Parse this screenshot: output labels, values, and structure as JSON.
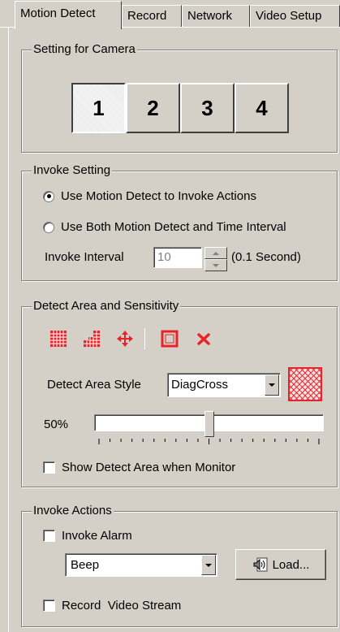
{
  "tabs": [
    "Motion Detect",
    "Record",
    "Network",
    "Video Setup"
  ],
  "camera_group": {
    "title": "Setting for Camera",
    "buttons": [
      "1",
      "2",
      "3",
      "4"
    ],
    "selected": "1"
  },
  "invoke_setting": {
    "title": "Invoke Setting",
    "option1": "Use Motion Detect to Invoke Actions",
    "option2": "Use Both Motion Detect and Time Interval",
    "selected": "option1",
    "interval_label": "Invoke Interval",
    "interval_value": "10",
    "interval_unit": "(0.1 Second)"
  },
  "detect_area": {
    "title": "Detect Area and Sensitivity",
    "tools": [
      "grid-all-icon",
      "grid-stairs-icon",
      "move-icon",
      "select-rect-icon",
      "clear-icon"
    ],
    "style_label": "Detect Area Style",
    "style_value": "DiagCross",
    "sensitivity_label": "50%",
    "sensitivity_value": 50,
    "show_label": "Show Detect Area when Monitor",
    "accent": "#e8242a"
  },
  "invoke_actions": {
    "title": "Invoke Actions",
    "alarm_label": "Invoke Alarm",
    "sound_value": "Beep",
    "load_label": "Load...",
    "record_label": "Record  Video Stream"
  }
}
